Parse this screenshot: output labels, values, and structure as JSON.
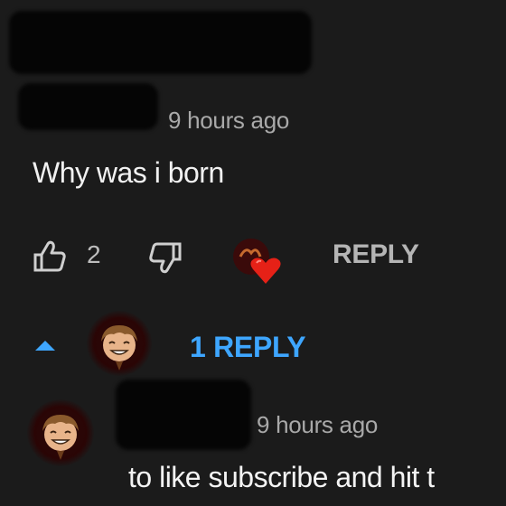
{
  "comment": {
    "timestamp": "9 hours ago",
    "text": "Why was i born",
    "like_count": "2",
    "reply_label": "REPLY",
    "icons": [
      "thumbs-up-icon",
      "thumbs-down-icon",
      "hearted-avatar-icon"
    ]
  },
  "replies": {
    "toggle_label": "1 REPLY",
    "toggle_icon": "caret-up-icon",
    "accent_color": "#3ea6ff"
  },
  "reply": {
    "timestamp": "9 hours ago",
    "text": "to like subscribe and hit t"
  }
}
